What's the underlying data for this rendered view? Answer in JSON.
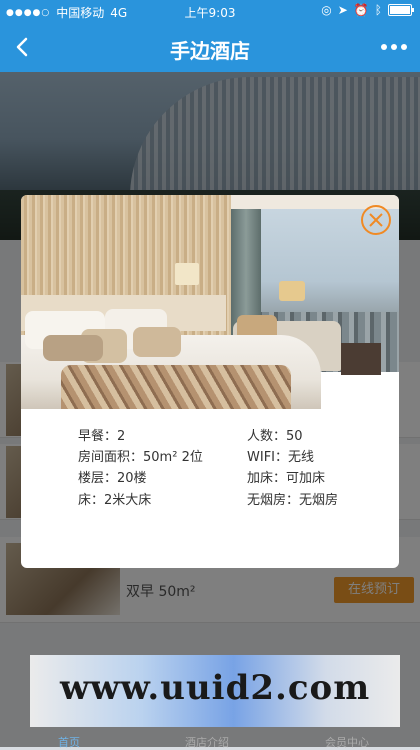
{
  "status_bar": {
    "signal": "●●●●○",
    "carrier": "中国移动",
    "network": "4G",
    "time": "上午9:03"
  },
  "nav": {
    "title": "手边酒店"
  },
  "background": {
    "room_row_text": "双早 50m²",
    "book_button": "在线预订",
    "tabs": [
      "首页",
      "酒店介绍",
      "会员中心"
    ]
  },
  "modal": {
    "details": [
      {
        "label": "早餐：",
        "value": "2"
      },
      {
        "label": "人数：",
        "value": "50"
      },
      {
        "label": "房间面积：",
        "value": "50m² 2位"
      },
      {
        "label": "WIFI：",
        "value": "无线"
      },
      {
        "label": "楼层：",
        "value": "20楼"
      },
      {
        "label": "加床：",
        "value": "可加床"
      },
      {
        "label": "床：",
        "value": "2米大床"
      },
      {
        "label": "无烟房：",
        "value": "无烟房"
      }
    ]
  },
  "watermark": "www.uuid2.com",
  "colors": {
    "primary": "#2a94dc",
    "accent": "#f08a24"
  }
}
